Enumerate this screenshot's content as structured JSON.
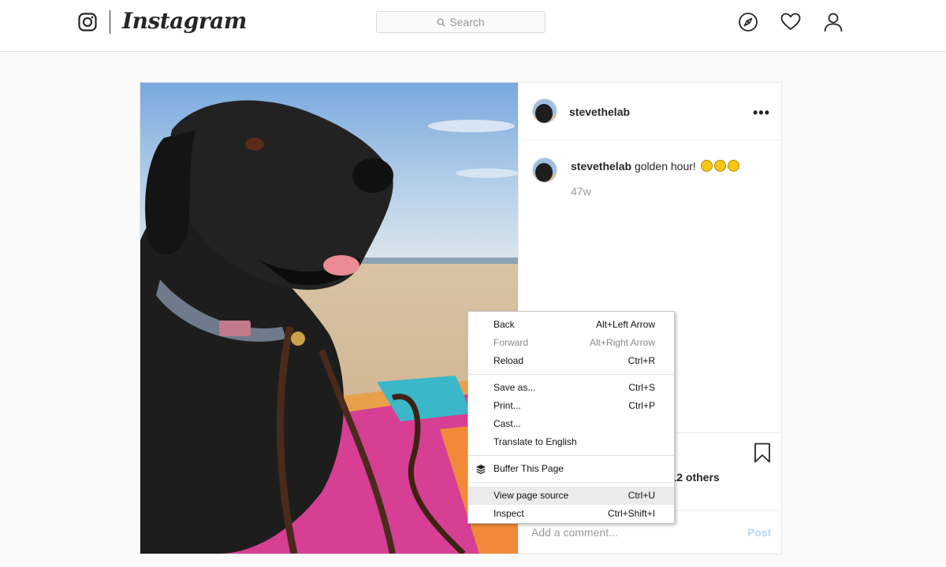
{
  "header": {
    "brand": "Instagram",
    "search_placeholder": "Search",
    "icons": [
      "instagram-logo-icon",
      "compass-icon",
      "heart-icon",
      "profile-icon"
    ]
  },
  "post": {
    "username": "stevethelab",
    "more_label": "•••",
    "caption_user": "stevethelab",
    "caption_text": "golden hour!",
    "timestamp": "47w",
    "likes_text": "d 12 others",
    "comment_placeholder": "Add a comment...",
    "post_label": "Post"
  },
  "context_menu": {
    "groups": [
      [
        {
          "label": "Back",
          "shortcut": "Alt+Left Arrow"
        },
        {
          "label": "Forward",
          "shortcut": "Alt+Right Arrow",
          "disabled": true
        },
        {
          "label": "Reload",
          "shortcut": "Ctrl+R"
        }
      ],
      [
        {
          "label": "Save as...",
          "shortcut": "Ctrl+S"
        },
        {
          "label": "Print...",
          "shortcut": "Ctrl+P"
        },
        {
          "label": "Cast...",
          "shortcut": ""
        },
        {
          "label": "Translate to English",
          "shortcut": ""
        }
      ],
      [
        {
          "label": "Buffer This Page",
          "shortcut": "",
          "icon": "buffer-icon"
        }
      ],
      [
        {
          "label": "View page source",
          "shortcut": "Ctrl+U",
          "hovered": true
        },
        {
          "label": "Inspect",
          "shortcut": "Ctrl+Shift+I"
        }
      ]
    ]
  },
  "colors": {
    "header_bg": "#ffffff",
    "page_bg": "#fafafa",
    "border": "#dbdbdb",
    "muted_text": "#999999",
    "post_button": "#b3dbff",
    "menu_hover": "#ebebeb"
  }
}
